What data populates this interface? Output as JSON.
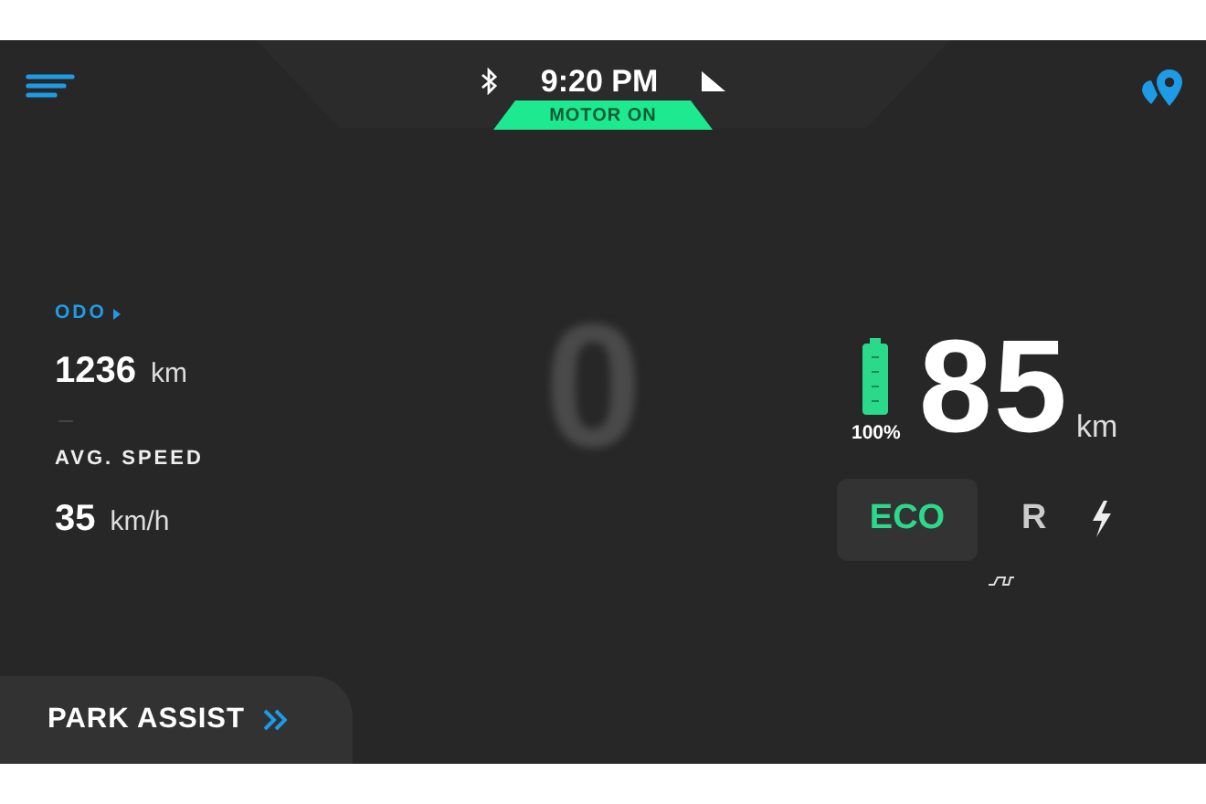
{
  "status_bar": {
    "time": "9:20 PM",
    "motor_status": "MOTOR ON",
    "bluetooth": true
  },
  "trip": {
    "odo_label": "ODO",
    "odo_value": "1236",
    "odo_unit": "km",
    "avg_label": "AVG. SPEED",
    "avg_value": "35",
    "avg_unit": "km/h"
  },
  "speed": {
    "value": "0"
  },
  "range": {
    "battery": {
      "level": 1.0,
      "percent": "100%"
    },
    "value": "85",
    "unit": "km"
  },
  "modes": [
    {
      "label": "ECO",
      "selected": true
    },
    {
      "label": "R",
      "selected": false
    }
  ],
  "park_assist": {
    "label": "PARK ASSIST"
  }
}
